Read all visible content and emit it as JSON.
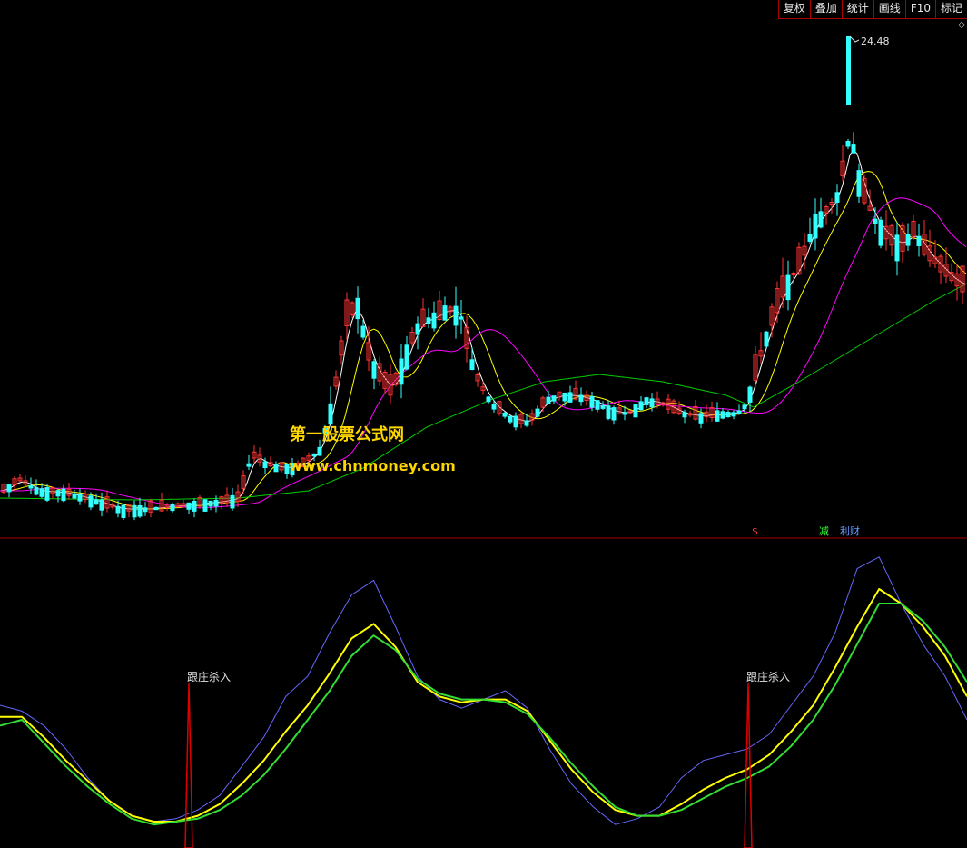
{
  "toolbar": {
    "buttons": [
      "复权",
      "叠加",
      "统计",
      "画线",
      "F10",
      "标记"
    ]
  },
  "price_panel": {
    "peak_label": "24.48",
    "markers": [
      {
        "text": "$",
        "color": "#ff3333"
      },
      {
        "text": "减",
        "color": "#33ff33"
      },
      {
        "text": "利财",
        "color": "#6699ff"
      }
    ]
  },
  "watermark": {
    "title": "第一股票公式网",
    "url": "www.chnmoney.com"
  },
  "indicator_panel": {
    "signal_label": "跟庄杀入"
  },
  "colors": {
    "up_candle": "#ff3333",
    "down_candle": "#33ffff",
    "ma_fast": "#ffffff",
    "ma_mid": "#ffff00",
    "ma_slow": "#ff00ff",
    "ma_long": "#00cc00",
    "osc_blue": "#6666ff",
    "osc_yellow": "#ffff00",
    "osc_green": "#33dd33",
    "signal": "#dd0000",
    "divider": "#aa0000"
  },
  "chart_data": {
    "type": "line",
    "series": [
      {
        "values": [
          0.45,
          0.43,
          0.38,
          0.3,
          0.2,
          0.12,
          0.07,
          0.05,
          0.06,
          0.09,
          0.14,
          0.24,
          0.34,
          0.48,
          0.55,
          0.7,
          0.83,
          0.88,
          0.72,
          0.55,
          0.47,
          0.44,
          0.47,
          0.5,
          0.44,
          0.3,
          0.18,
          0.1,
          0.04,
          0.06,
          0.1,
          0.2,
          0.26,
          0.28,
          0.3,
          0.35,
          0.45,
          0.55,
          0.7,
          0.92,
          0.96,
          0.8,
          0.66,
          0.55,
          0.4
        ]
      },
      {
        "values": [
          0.41,
          0.41,
          0.34,
          0.26,
          0.19,
          0.12,
          0.07,
          0.05,
          0.05,
          0.07,
          0.11,
          0.18,
          0.26,
          0.36,
          0.45,
          0.56,
          0.68,
          0.73,
          0.65,
          0.53,
          0.48,
          0.46,
          0.47,
          0.47,
          0.43,
          0.33,
          0.23,
          0.15,
          0.09,
          0.07,
          0.07,
          0.11,
          0.16,
          0.2,
          0.23,
          0.28,
          0.36,
          0.45,
          0.58,
          0.72,
          0.85,
          0.8,
          0.72,
          0.62,
          0.48
        ]
      },
      {
        "values": [
          0.38,
          0.4,
          0.32,
          0.24,
          0.17,
          0.11,
          0.06,
          0.04,
          0.05,
          0.06,
          0.09,
          0.14,
          0.21,
          0.3,
          0.4,
          0.5,
          0.62,
          0.69,
          0.64,
          0.54,
          0.49,
          0.47,
          0.47,
          0.46,
          0.42,
          0.34,
          0.25,
          0.17,
          0.1,
          0.07,
          0.07,
          0.09,
          0.13,
          0.17,
          0.2,
          0.24,
          0.31,
          0.4,
          0.52,
          0.66,
          0.8,
          0.8,
          0.74,
          0.65,
          0.53
        ]
      }
    ]
  }
}
